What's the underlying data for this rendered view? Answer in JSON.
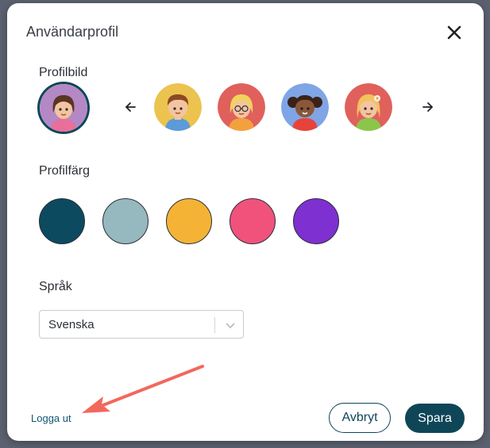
{
  "dialog": {
    "title": "Användarprofil"
  },
  "profile_picture": {
    "label": "Profilbild",
    "icons": {
      "close": "close-icon",
      "prev": "arrow-left-icon",
      "next": "arrow-right-icon"
    }
  },
  "profile_color": {
    "label": "Profilfärg",
    "swatches": [
      "#0c4a60",
      "#96b8bf",
      "#f5b335",
      "#f0527c",
      "#7f30d0"
    ]
  },
  "language": {
    "label": "Språk",
    "selected": "Svenska"
  },
  "footer": {
    "logout": "Logga ut",
    "cancel": "Avbryt",
    "save": "Spara"
  },
  "colors": {
    "accent": "#0e4658",
    "annotation_arrow": "#f2685c"
  }
}
